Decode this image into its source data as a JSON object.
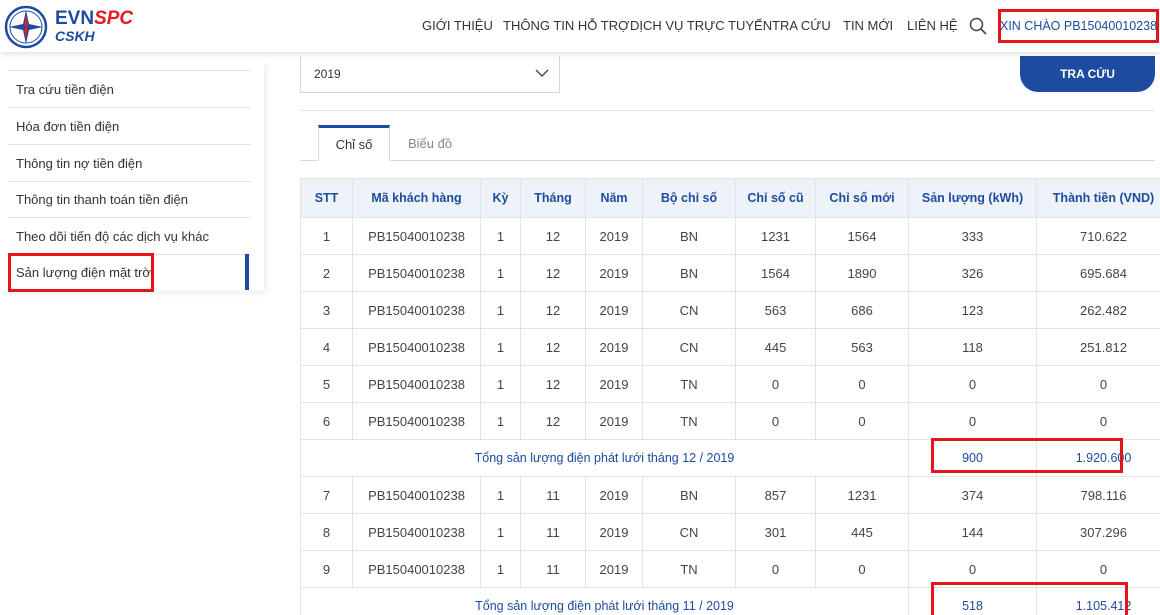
{
  "brand": {
    "evn": "EVN",
    "spc": "SPC",
    "sub": "CSKH"
  },
  "nav": [
    {
      "label": "GIỚI THIỆU"
    },
    {
      "label": "THÔNG TIN HỖ TRỢ"
    },
    {
      "label": "DỊCH VỤ TRỰC TUYẾN"
    },
    {
      "label": "TRA CỨU"
    },
    {
      "label": "TIN MỚI"
    },
    {
      "label": "LIÊN HỆ"
    }
  ],
  "greeting": "XIN CHÀO PB15040010238",
  "sidebar": {
    "items": [
      {
        "label": "Tra cứu tiền điện"
      },
      {
        "label": "Hóa đơn tiền điện"
      },
      {
        "label": "Thông tin nợ tiền điện"
      },
      {
        "label": "Thông tin thanh toán tiền điện"
      },
      {
        "label": "Theo dõi tiến độ các dịch vụ khác"
      },
      {
        "label": "Sản lượng điện mặt trời"
      }
    ]
  },
  "filter": {
    "year": "2019",
    "search_label": "TRA CỨU"
  },
  "tabs": [
    {
      "label": "Chỉ số"
    },
    {
      "label": "Biểu đồ"
    }
  ],
  "table": {
    "headers": [
      "STT",
      "Mã khách hàng",
      "Kỳ",
      "Tháng",
      "Năm",
      "Bộ chỉ số",
      "Chỉ số cũ",
      "Chỉ số mới",
      "Sản lượng (kWh)",
      "Thành tiền (VND)"
    ],
    "rows": [
      {
        "stt": "1",
        "ma": "PB15040010238",
        "ky": "1",
        "thang": "12",
        "nam": "2019",
        "bo": "BN",
        "cu": "1231",
        "moi": "1564",
        "sl": "333",
        "tien": "710.622"
      },
      {
        "stt": "2",
        "ma": "PB15040010238",
        "ky": "1",
        "thang": "12",
        "nam": "2019",
        "bo": "BN",
        "cu": "1564",
        "moi": "1890",
        "sl": "326",
        "tien": "695.684"
      },
      {
        "stt": "3",
        "ma": "PB15040010238",
        "ky": "1",
        "thang": "12",
        "nam": "2019",
        "bo": "CN",
        "cu": "563",
        "moi": "686",
        "sl": "123",
        "tien": "262.482"
      },
      {
        "stt": "4",
        "ma": "PB15040010238",
        "ky": "1",
        "thang": "12",
        "nam": "2019",
        "bo": "CN",
        "cu": "445",
        "moi": "563",
        "sl": "118",
        "tien": "251.812"
      },
      {
        "stt": "5",
        "ma": "PB15040010238",
        "ky": "1",
        "thang": "12",
        "nam": "2019",
        "bo": "TN",
        "cu": "0",
        "moi": "0",
        "sl": "0",
        "tien": "0"
      },
      {
        "stt": "6",
        "ma": "PB15040010238",
        "ky": "1",
        "thang": "12",
        "nam": "2019",
        "bo": "TN",
        "cu": "0",
        "moi": "0",
        "sl": "0",
        "tien": "0"
      },
      {
        "stt": "7",
        "ma": "PB15040010238",
        "ky": "1",
        "thang": "11",
        "nam": "2019",
        "bo": "BN",
        "cu": "857",
        "moi": "1231",
        "sl": "374",
        "tien": "798.116"
      },
      {
        "stt": "8",
        "ma": "PB15040010238",
        "ky": "1",
        "thang": "11",
        "nam": "2019",
        "bo": "CN",
        "cu": "301",
        "moi": "445",
        "sl": "144",
        "tien": "307.296"
      },
      {
        "stt": "9",
        "ma": "PB15040010238",
        "ky": "1",
        "thang": "11",
        "nam": "2019",
        "bo": "TN",
        "cu": "0",
        "moi": "0",
        "sl": "0",
        "tien": "0"
      }
    ],
    "totals": [
      {
        "label": "Tổng sản lượng điện phát lưới tháng 12 / 2019",
        "sl": "900",
        "tien": "1.920.600"
      },
      {
        "label": "Tổng sản lượng điện phát lưới tháng 11 / 2019",
        "sl": "518",
        "tien": "1.105.412"
      }
    ]
  }
}
